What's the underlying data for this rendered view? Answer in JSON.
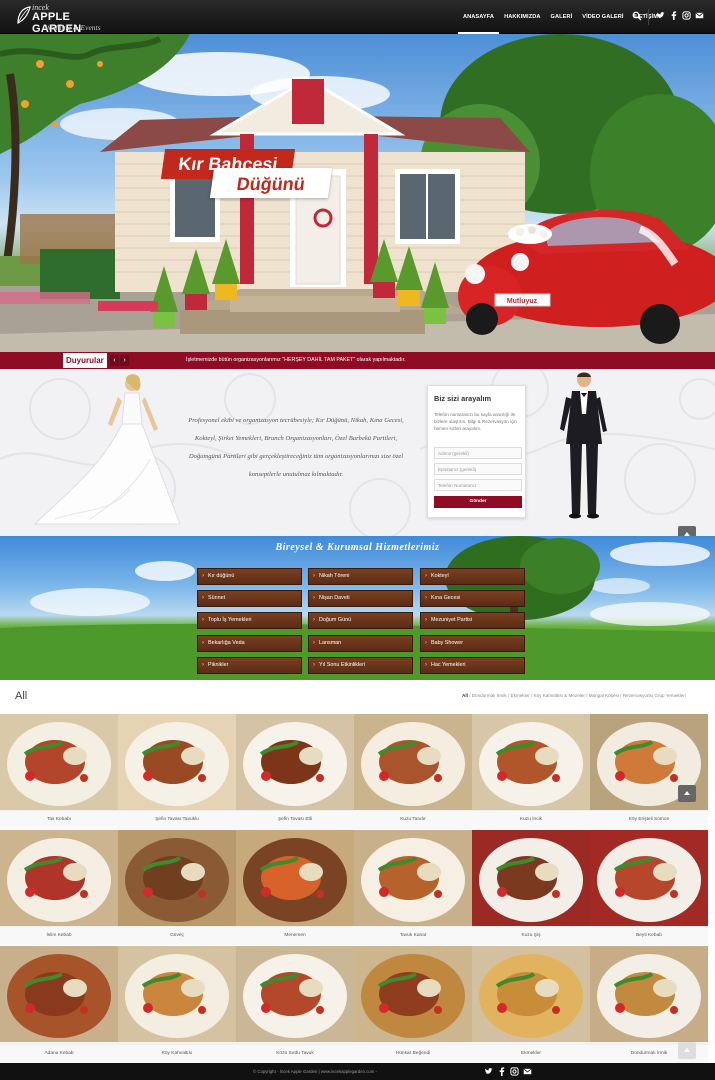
{
  "header": {
    "logo": {
      "line1": "incek",
      "line2": "APPLE GARDEN",
      "line3": "Wedding & Events"
    },
    "nav": [
      "ANASAYFA",
      "HAKKIMIZDA",
      "GALERİ",
      "VİDEO GALERİ",
      "İLETİŞİM"
    ],
    "social": [
      "twitter-icon",
      "facebook-icon",
      "instagram-icon",
      "mail-icon"
    ]
  },
  "hero": {
    "line1": "Kır Bahçesi",
    "line2": "Düğünü",
    "plate": "Mutluyuz"
  },
  "announcements": {
    "label": "Duyurular",
    "text": "İşletmemizde bütün organizasyonlarımız \"HERŞEY DAHİL TAM PAKET\" olarak yapılmaktadır."
  },
  "intro": {
    "text": "Profesyonel ekibi ve organizasyon tecrübesiyle; Kır Düğünü, Nikah, Kına Gecesi, Kokteyl, Şirket Yemekleri, Brunch Organizasyonları, Özel Barbekü Partileri, Doğumgünü Partileri gibi gerçekleştireceğiniz tüm organizasyonlarınızı size özel konseptlerle unutulmaz kılmaktadır."
  },
  "callform": {
    "title": "Biz sizi arayalım",
    "desc": "Telefon numaranızı bu sayfa aracılığı ile bizlere ulaştırın. Bilgi & Rezervasyon için hemen sizleri arayalım.",
    "name_placeholder": "Adınız (gerekli)",
    "email_placeholder": "Epostanız (gerekli)",
    "phone_placeholder": "Telefon Numaranız",
    "button": "Gönder"
  },
  "services": {
    "title": "Bireysel  & Kurumsal  Hizmetlerimiz",
    "col1": [
      "Kır düğünü",
      "Sünnet",
      "Toplu İş Yemekleri",
      "Bekarlığa Veda",
      "Piknikler"
    ],
    "col2": [
      "Nikah Töreni",
      "Nişan Daveti",
      "Doğum Günü",
      "Lansman",
      "Yıl Sonu Etkinlikleri"
    ],
    "col3": [
      "Kokteyl",
      "Kına Gecesi",
      "Mezuniyet Partisi",
      "Baby Shower",
      "Hac Yemekleri"
    ]
  },
  "gallery": {
    "title": "All",
    "filters": [
      "All",
      "Dondurmalı İrmik",
      "Ekmekler",
      "Köy Kahvaltısı & Mezeler",
      "Mangal Köşesi",
      "Rezervasyonlu Grup Yemekleri"
    ],
    "items": [
      {
        "caption": "Tas Kebabı",
        "bg": "#d9c9a8",
        "plate": "#f4efe3",
        "food": "#b3452a"
      },
      {
        "caption": "Şefin Tavası Tavuklu",
        "bg": "#e6d3b3",
        "plate": "#f6f1e6",
        "food": "#9a4a22"
      },
      {
        "caption": "Şefin Tavası Etli",
        "bg": "#d4c3a5",
        "plate": "#f7f3ea",
        "food": "#7d3519"
      },
      {
        "caption": "Kuzu Tandır",
        "bg": "#c9b48e",
        "plate": "#f4ede0",
        "food": "#a9542c"
      },
      {
        "caption": "Kuzu İncik",
        "bg": "#d8c7a6",
        "plate": "#f6f2ea",
        "food": "#b0562a"
      },
      {
        "caption": "Köy Erişteli Somon",
        "bg": "#b9a37c",
        "plate": "#f2ece0",
        "food": "#d07a3a"
      },
      {
        "caption": "İslim Kebab",
        "bg": "#cbb48e",
        "plate": "#f5efe3",
        "food": "#b0342a"
      },
      {
        "caption": "Güveç",
        "bg": "#b99a6c",
        "plate": "#8a5a34",
        "food": "#6f3f1f"
      },
      {
        "caption": "Menemen",
        "bg": "#c7aa7c",
        "plate": "#7a4424",
        "food": "#d7632a"
      },
      {
        "caption": "Tavuk Kanat",
        "bg": "#c8b08b",
        "plate": "#f5efe4",
        "food": "#b5622d"
      },
      {
        "caption": "Kuzu Şiş",
        "bg": "#9b2a24",
        "plate": "#f3efe8",
        "food": "#7b3a1f"
      },
      {
        "caption": "Beyti Kebab",
        "bg": "#a32a24",
        "plate": "#f3efe8",
        "food": "#b6472a"
      },
      {
        "caption": "Adana Kebab",
        "bg": "#c8b08c",
        "plate": "#a8542a",
        "food": "#8a3a1c"
      },
      {
        "caption": "Köy Kahvaltısı",
        "bg": "#d5c2a0",
        "plate": "#f4eee0",
        "food": "#c9863c"
      },
      {
        "caption": "Közü Sırdu Tavuk",
        "bg": "#c9b795",
        "plate": "#f6f2ea",
        "food": "#b3482a"
      },
      {
        "caption": "Hünkar Beğendi",
        "bg": "#cdb58e",
        "plate": "#c0873f",
        "food": "#8e3e1f"
      },
      {
        "caption": "Ekmekler",
        "bg": "#d3c0a0",
        "plate": "#e2b35f",
        "food": "#c98d3a"
      },
      {
        "caption": "Dondurmalı İrmik",
        "bg": "#c6ad88",
        "plate": "#f4efe6",
        "food": "#c28a3f"
      }
    ]
  },
  "footer": {
    "copyright": "© Copyright - İncek Apple Garden | www.incekapplegarden.com -",
    "social": [
      "twitter-icon",
      "facebook-icon",
      "instagram-icon",
      "mail-icon"
    ]
  },
  "colors": {
    "brand": "#8f0c25",
    "header": "#1a1a1a",
    "wood": "#6a3319"
  }
}
